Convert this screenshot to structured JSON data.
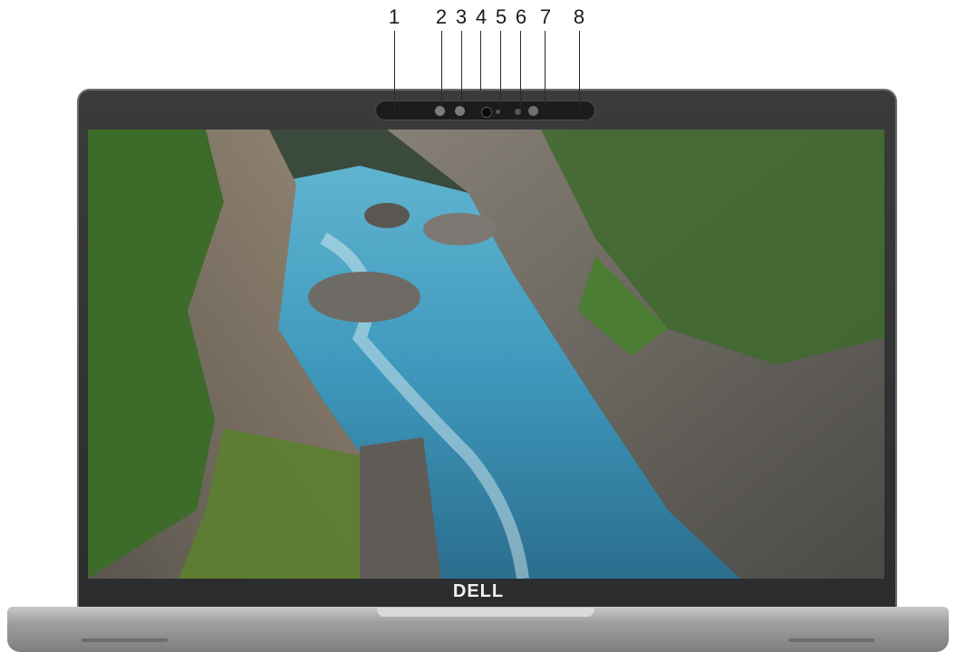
{
  "callouts": [
    "1",
    "2",
    "3",
    "4",
    "5",
    "6",
    "7",
    "8"
  ],
  "brand_logo": "DELL",
  "colors": {
    "lid": "#2f3032",
    "base": "#a3a4a6",
    "screen_water": "#4fa3c4",
    "screen_foliage": "#3d6b2a"
  },
  "icons": [
    "camera-lens-icon",
    "sensor-icon",
    "light-sensor-icon",
    "led-indicator-icon"
  ]
}
